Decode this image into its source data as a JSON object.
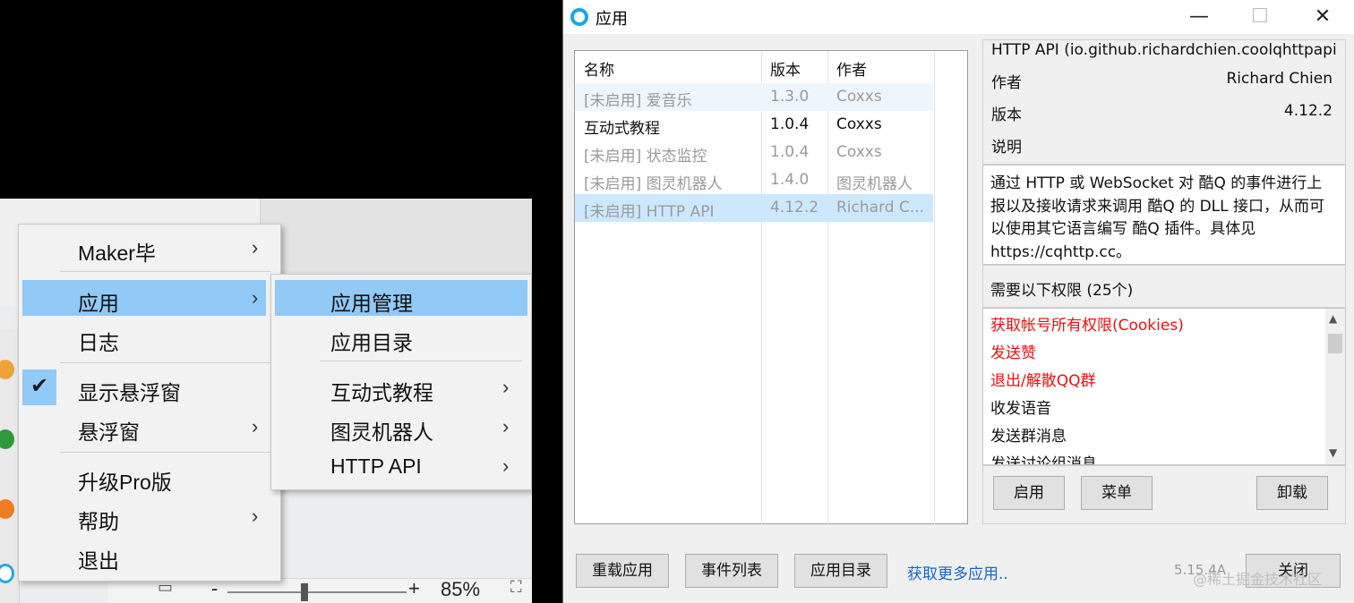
{
  "context_menu": {
    "main_items": [
      {
        "label": "Maker毕",
        "has_submenu": true
      },
      {
        "label": "应用",
        "has_submenu": true,
        "highlighted": true
      },
      {
        "label": "日志",
        "has_submenu": false
      },
      {
        "label": "显示悬浮窗",
        "has_submenu": false,
        "checked": true
      },
      {
        "label": "悬浮窗",
        "has_submenu": true
      },
      {
        "label": "升级Pro版",
        "has_submenu": false
      },
      {
        "label": "帮助",
        "has_submenu": true
      },
      {
        "label": "退出",
        "has_submenu": false
      }
    ],
    "submenu_items": [
      {
        "label": "应用管理",
        "highlighted": true,
        "has_submenu": false
      },
      {
        "label": "应用目录",
        "has_submenu": false
      },
      {
        "label": "互动式教程",
        "has_submenu": true
      },
      {
        "label": "图灵机器人",
        "has_submenu": true
      },
      {
        "label": "HTTP API",
        "has_submenu": true
      }
    ],
    "arrow_glyph": "›",
    "check_glyph": "✔"
  },
  "statusbar": {
    "zoom_minus": "-",
    "zoom_plus": "+",
    "zoom": "85%"
  },
  "window": {
    "title": "应用",
    "minimize": "—",
    "maximize": "☐",
    "close": "✕",
    "list": {
      "columns": [
        "名称",
        "版本",
        "作者"
      ],
      "rows": [
        {
          "name": "[未启用] 爱音乐",
          "version": "1.3.0",
          "author": "Coxxs",
          "enabled": false
        },
        {
          "name": "互动式教程",
          "version": "1.0.4",
          "author": "Coxxs",
          "enabled": true
        },
        {
          "name": "[未启用] 状态监控",
          "version": "1.0.4",
          "author": "Coxxs",
          "enabled": false
        },
        {
          "name": "[未启用] 图灵机器人",
          "version": "1.4.0",
          "author": "图灵机器人",
          "enabled": false
        },
        {
          "name": "[未启用] HTTP API",
          "version": "4.12.2",
          "author": "Richard C...",
          "enabled": false,
          "selected": true
        }
      ]
    },
    "detail": {
      "name": "HTTP API (io.github.richardchien.coolqhttpapi",
      "author_label": "作者",
      "author": "Richard Chien",
      "version_label": "版本",
      "version": "4.12.2",
      "desc_label": "说明",
      "description": "通过 HTTP 或 WebSocket 对 酷Q 的事件进行上报以及接收请求来调用 酷Q 的 DLL 接口，从而可以使用其它语言编写 酷Q 插件。具体见 https://cqhttp.cc。",
      "permissions_title": "需要以下权限 (25个)",
      "permissions": [
        {
          "label": "获取帐号所有权限(Cookies)",
          "danger": true
        },
        {
          "label": "发送赞",
          "danger": true
        },
        {
          "label": "退出/解散QQ群",
          "danger": true
        },
        {
          "label": "收发语音",
          "danger": false
        },
        {
          "label": "发送群消息",
          "danger": false
        },
        {
          "label": "发送讨论组消息",
          "danger": false
        }
      ],
      "buttons": {
        "enable": "启用",
        "menu": "菜单",
        "uninstall": "卸载"
      }
    },
    "footer": {
      "reload": "重载应用",
      "events": "事件列表",
      "app_dir": "应用目录",
      "more_link": "获取更多应用..",
      "version": "5.15.4A",
      "close": "关闭"
    }
  },
  "watermark": "@稀土掘金技术社区",
  "colors": {
    "highlight": "#91c9f7",
    "selected_row": "#cce8ff",
    "danger": "#e81010",
    "link": "#1467c8"
  }
}
